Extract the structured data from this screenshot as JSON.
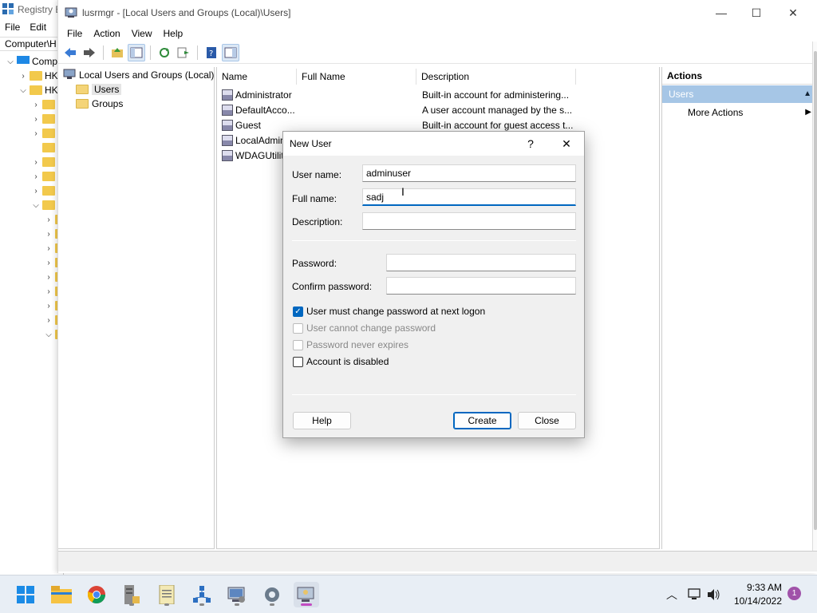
{
  "regedit": {
    "title": "Registry E",
    "menu": [
      "File",
      "Edit"
    ],
    "address": "Computer\\H",
    "root": "Comp",
    "hk1": "HK",
    "hk2": "HK"
  },
  "mmc": {
    "title": "lusrmgr - [Local Users and Groups (Local)\\Users]",
    "menu": [
      "File",
      "Action",
      "View",
      "Help"
    ],
    "tree": {
      "root": "Local Users and Groups (Local)",
      "users": "Users",
      "groups": "Groups"
    },
    "list": {
      "columns": [
        "Name",
        "Full Name",
        "Description"
      ],
      "rows": [
        {
          "name": "Administrator",
          "full_name": "",
          "description": "Built-in account for administering..."
        },
        {
          "name": "DefaultAcco...",
          "full_name": "",
          "description": "A user account managed by the s..."
        },
        {
          "name": "Guest",
          "full_name": "",
          "description": "Built-in account for guest access t..."
        },
        {
          "name": "LocalAdmin",
          "full_name": "",
          "description": ""
        },
        {
          "name": "WDAGUtilit",
          "full_name": "",
          "description": ""
        }
      ]
    },
    "actions": {
      "header": "Actions",
      "section": "Users",
      "more": "More Actions"
    }
  },
  "dialog": {
    "title": "New User",
    "help_glyph": "?",
    "username_label": "User name:",
    "username_value": "adminuser",
    "fullname_label": "Full name:",
    "fullname_value": "sadj",
    "description_label": "Description:",
    "description_value": "",
    "password_label": "Password:",
    "confirm_label": "Confirm password:",
    "checks": [
      {
        "label": "User must change password at next logon",
        "checked": true,
        "disabled": false
      },
      {
        "label": "User cannot change password",
        "checked": false,
        "disabled": true
      },
      {
        "label": "Password never expires",
        "checked": false,
        "disabled": true
      },
      {
        "label": "Account is disabled",
        "checked": false,
        "disabled": false
      }
    ],
    "help_button": "Help",
    "create_button": "Create",
    "close_button": "Close"
  },
  "taskbar": {
    "time": "9:33 AM",
    "date": "10/14/2022",
    "notifications": "1",
    "icons": [
      "start-icon",
      "file-explorer-icon",
      "chrome-icon",
      "server-manager-icon",
      "notepad-icon",
      "network-icon",
      "computer-management-icon",
      "settings-icon",
      "lusrmgr-icon"
    ]
  },
  "colors": {
    "accent": "#0067c0",
    "actions_section": "#a6c6e6",
    "taskbar": "#e8eef5"
  }
}
